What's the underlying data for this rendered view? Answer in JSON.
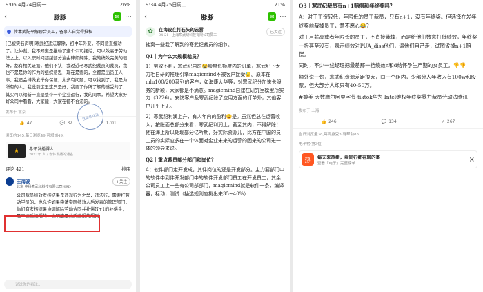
{
  "p1": {
    "status_time": "9:06",
    "status_date": "4月24日周一",
    "status_right": "26%",
    "title": "脉脉",
    "banner": "传本武配平解聊合员工，备事人自觉得推权",
    "body": "[已被实名声明]寒武纪违法解除，初中年外变，不同意直接劝了。让仲裁，我不知道是推动了这个公司摆烂，可以效高于劳动法之上，以入职时间超越部分治由律师解除，我的绩效完美的很好，都有相关证据，他们不认，我过近老寒武纪裁员的裁员，我也不是是你的作为的组织意思，现在是要的，全都是出员工人事，我还会排做发举你保证，太多有问题，可以找到了，我是为所有的人，我说前这里这只是好，我要了你所了解的感受的了，其实可以给新一直是整个一个企业运行，我的同事，希望大家好好公司中看看，大家能，大家在都不合法的。",
    "stamp": "已实名认证",
    "meta": "发布于 北京",
    "likes": "47",
    "comments": "32",
    "shares": "1701",
    "extra": "转发",
    "read_info": "浏览约145,每日浏览49,可增加49,",
    "mini_title": "赤怀发播得人",
    "mini_sub": "2022年 人 / 赤怀发播的通名",
    "comments_header": "评论 421",
    "sort": "排序",
    "commenter_name": "王海波",
    "commenter_desc": "北京 中科寒武纪科技有限公司HRD",
    "follow": "+关注",
    "comment_text": "公司裁员绩效考核结果是违规行为之举，违法行，需要打劳动学员的，也允许如果申请实际绩效人后发表的管理部门，你们有考核结果协调解除劳动合同并补偿N+1的补偿金，是不违反法规的，说明这是优质违规的规则",
    "input": "说说你的看法..."
  },
  "p2": {
    "status_time": "9:34",
    "status_date": "4月25日周二",
    "status_right": "21%",
    "title": "脉脉",
    "author_name": "在海设在打石头的云雾",
    "author_desc": "04-21 · 上海寒武纪科技有限公司员工",
    "follow": "已关注",
    "intro": "抽窝一些我了解到的寒武纪裁员的细节。",
    "q1": "Q1｜为什么大规模裁员？",
    "a1": "1）劳收不利，寒武纪自前😭殷度低额度内的订单，寒武纪下太力毛自研的推理引擎magicmind不被客户接受😓。原本在mlu100/200系列的客户，如海康大华等，对寒武纪分加速卡服务的新颖，大家都是不满意。magicmind自建在研究室模型所实力（3226）。安防客户及寒武纪除了应用方面的订单外，其他客户几乎上无。",
    "a2": "2）寒武纪利润上升，有人年内的盈利😄是。虽然但总在运营收入，按账面总部分来看，寒武纪利润上，截至其内，不得解除！他在海上所以处现部分亿所期，好实际资源几，比方在中国的员工员的实际应多在一个体面对企业未来的运营的团来的公司进一体的领导来说。",
    "q2": "Q2｜重点裁员部分部门和岗位？",
    "a3": "A：软件部门走开发成，其件岗位的还是开发部分。主力要部门中的软件中到件开发部门中的软件开发部门员工在开发员工，其余公司员工上一些有公司部部门，magicmind就是软件一条，编译器，标动，测试（抽选规则应挑出来35~40%）"
  },
  "p3": {
    "q3": "Q3｜寒武纪裁员有n+1赔偿和年终奖吗？",
    "a1": "A：对于工资较低，年限低的员工裁员，只有n+1，没有年终奖。但选择在发年终奖前裁掉员工，意不愿心😂？",
    "a2": "对于月薪高或者年限长的员工，不直接裁掉，而是给他们数意打低绩效，年终奖一折甚至没有，表示绩效对PUA_diss他们，逼他们自己走，试图省掉n+1赔偿。",
    "a3": "同时，不少一线经理把最差那一档绩效n和d给怀孕生产期的女员工。👎👎",
    "a4": "额外说一句，寒武纪资源差距很大，同一个组内，少部分人年收入有100w和股票，但大部分人却只有40-50万。",
    "tags": "#媲美 天数摩尔阿里字节-tiktok华为 Intel维权年终奖暴力裁员劳动法腾讯",
    "meta": "发布于 上海",
    "likes": "246",
    "comments": "134",
    "shares": "267",
    "read_info": "当日浏览量38,每周身受3,有帮助83",
    "topic_label": "电子榜·第3位",
    "promo_title": "每天来热榜，看同行都在聊的事",
    "promo_sub": "查看「电子」完整榜单"
  }
}
